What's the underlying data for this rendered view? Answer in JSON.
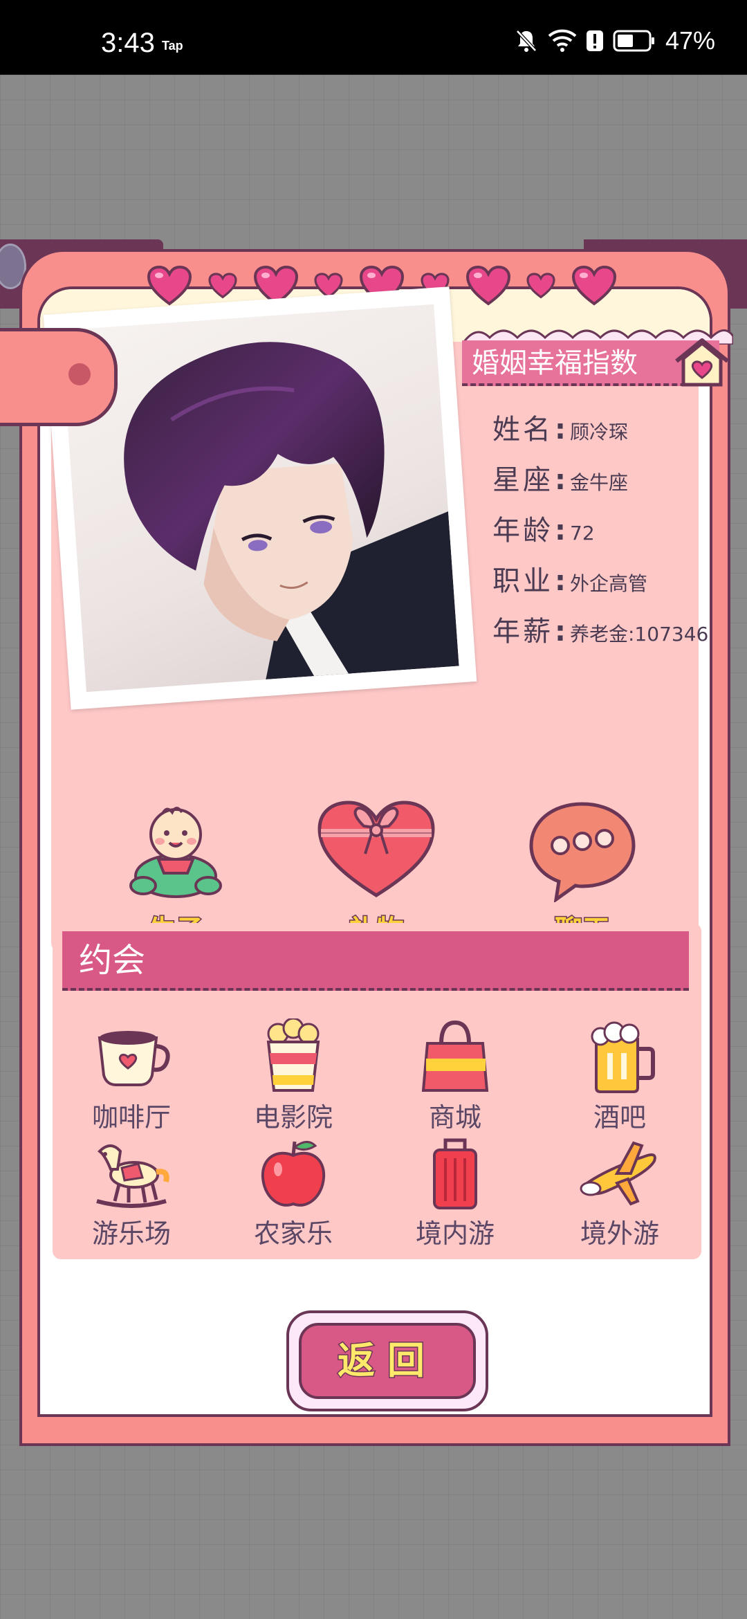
{
  "status_bar": {
    "time": "3:43",
    "tap_label": "Tap",
    "battery_percent": "47%"
  },
  "profile": {
    "title": "婚姻幸福指数",
    "fields": [
      {
        "label": "姓名",
        "value": "顾冷琛"
      },
      {
        "label": "星座",
        "value": "金牛座"
      },
      {
        "label": "年龄",
        "value": "72"
      },
      {
        "label": "职业",
        "value": "外企高管"
      },
      {
        "label": "年薪",
        "value": "养老金:107346"
      }
    ]
  },
  "actions": [
    {
      "label": "生子",
      "icon": "baby-icon"
    },
    {
      "label": "礼物",
      "icon": "gift-heart-icon"
    },
    {
      "label": "聊天",
      "icon": "chat-bubble-icon"
    }
  ],
  "date": {
    "title": "约会",
    "items": [
      {
        "label": "咖啡厅",
        "icon": "coffee-icon"
      },
      {
        "label": "电影院",
        "icon": "popcorn-icon"
      },
      {
        "label": "商城",
        "icon": "shopping-bag-icon"
      },
      {
        "label": "酒吧",
        "icon": "beer-icon"
      },
      {
        "label": "游乐场",
        "icon": "rocking-horse-icon"
      },
      {
        "label": "农家乐",
        "icon": "apple-icon"
      },
      {
        "label": "境内游",
        "icon": "suitcase-icon"
      },
      {
        "label": "境外游",
        "icon": "airplane-icon"
      }
    ]
  },
  "return_label": "返回",
  "colors": {
    "frame": "#f98f8c",
    "outline": "#6b3656",
    "panel": "#fec8c7",
    "accent": "#d85985"
  }
}
